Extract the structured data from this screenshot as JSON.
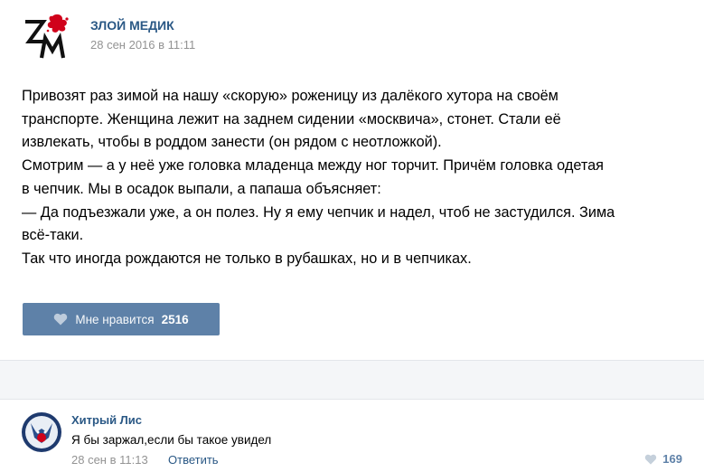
{
  "post": {
    "author": "ЗЛОЙ МЕДИК",
    "date": "28 сен 2016 в 11:11",
    "logo_icon": "zm-logo-with-red-splash",
    "text_lines": [
      "Привозят раз зимой на нашу «скорую» роженицу из далёкого хутора на своём",
      "транспорте. Женщина лежит на заднем сидении «москвича», стонет. Стали её",
      "извлекать, чтобы в роддом занести (он рядом с неотложкой).",
      "Смотрим — а у неё уже головка младенца между ног торчит. Причём головка одетая",
      "в чепчик. Мы в осадок выпали, а папаша объясняет:",
      "— Да подъезжали уже, а он полез. Ну я ему чепчик и надел, чтоб не застудился. Зима",
      "всё-таки.",
      "Так что иногда рождаются не только в рубашках, но и в чепчиках."
    ],
    "like_label": "Мне нравится",
    "like_count": "2516",
    "like_icon": "heart-icon"
  },
  "comment": {
    "author": "Хитрый Лис",
    "text": "Я бы заржал,если бы такое увидел",
    "date": "28 сен в 11:13",
    "reply_label": "Ответить",
    "like_count": "169",
    "avatar_icon": "fox-avatar"
  },
  "colors": {
    "link": "#2a5885",
    "like_button": "#5e81a8",
    "muted": "#939393",
    "logo_red": "#d0021b"
  }
}
